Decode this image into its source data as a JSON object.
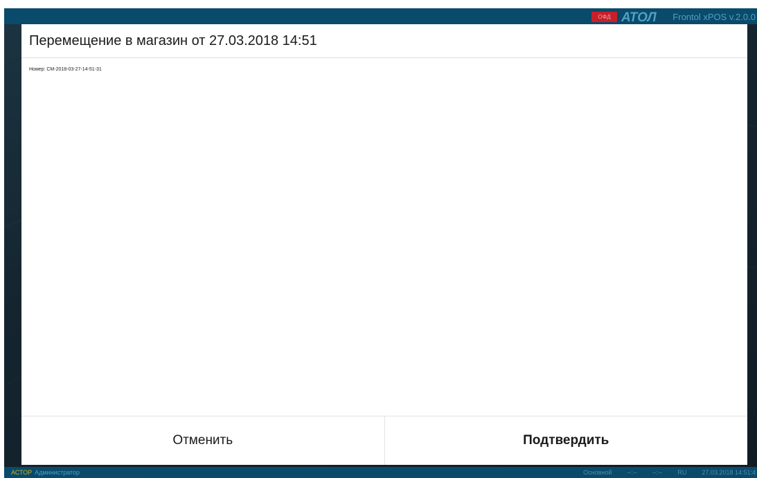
{
  "header": {
    "ofd_badge": "ОФД",
    "brand_logo": "АТОЛ",
    "app_version": "Frontol xPOS v.2.0.0"
  },
  "dialog": {
    "title": "Перемещение в магазин от 27.03.2018 14:51",
    "number_line": "Номер: СМ-2018-03-27-14-51-31",
    "cancel_label": "Отменить",
    "confirm_label": "Подтвердить"
  },
  "status_bar": {
    "company": "АСТОР",
    "user": "Администратор",
    "mode": "Основной",
    "field_1": "--:--",
    "field_2": "--:--",
    "language": "RU",
    "datetime": "27.03.2018 14:51:4"
  },
  "colors": {
    "top_bar": "#0a4a6a",
    "ofd_badge": "#c8202a",
    "accent_text": "#4fa0c6",
    "company_text": "#c9b21e"
  },
  "icons": [
    "atol-logo-icon"
  ]
}
